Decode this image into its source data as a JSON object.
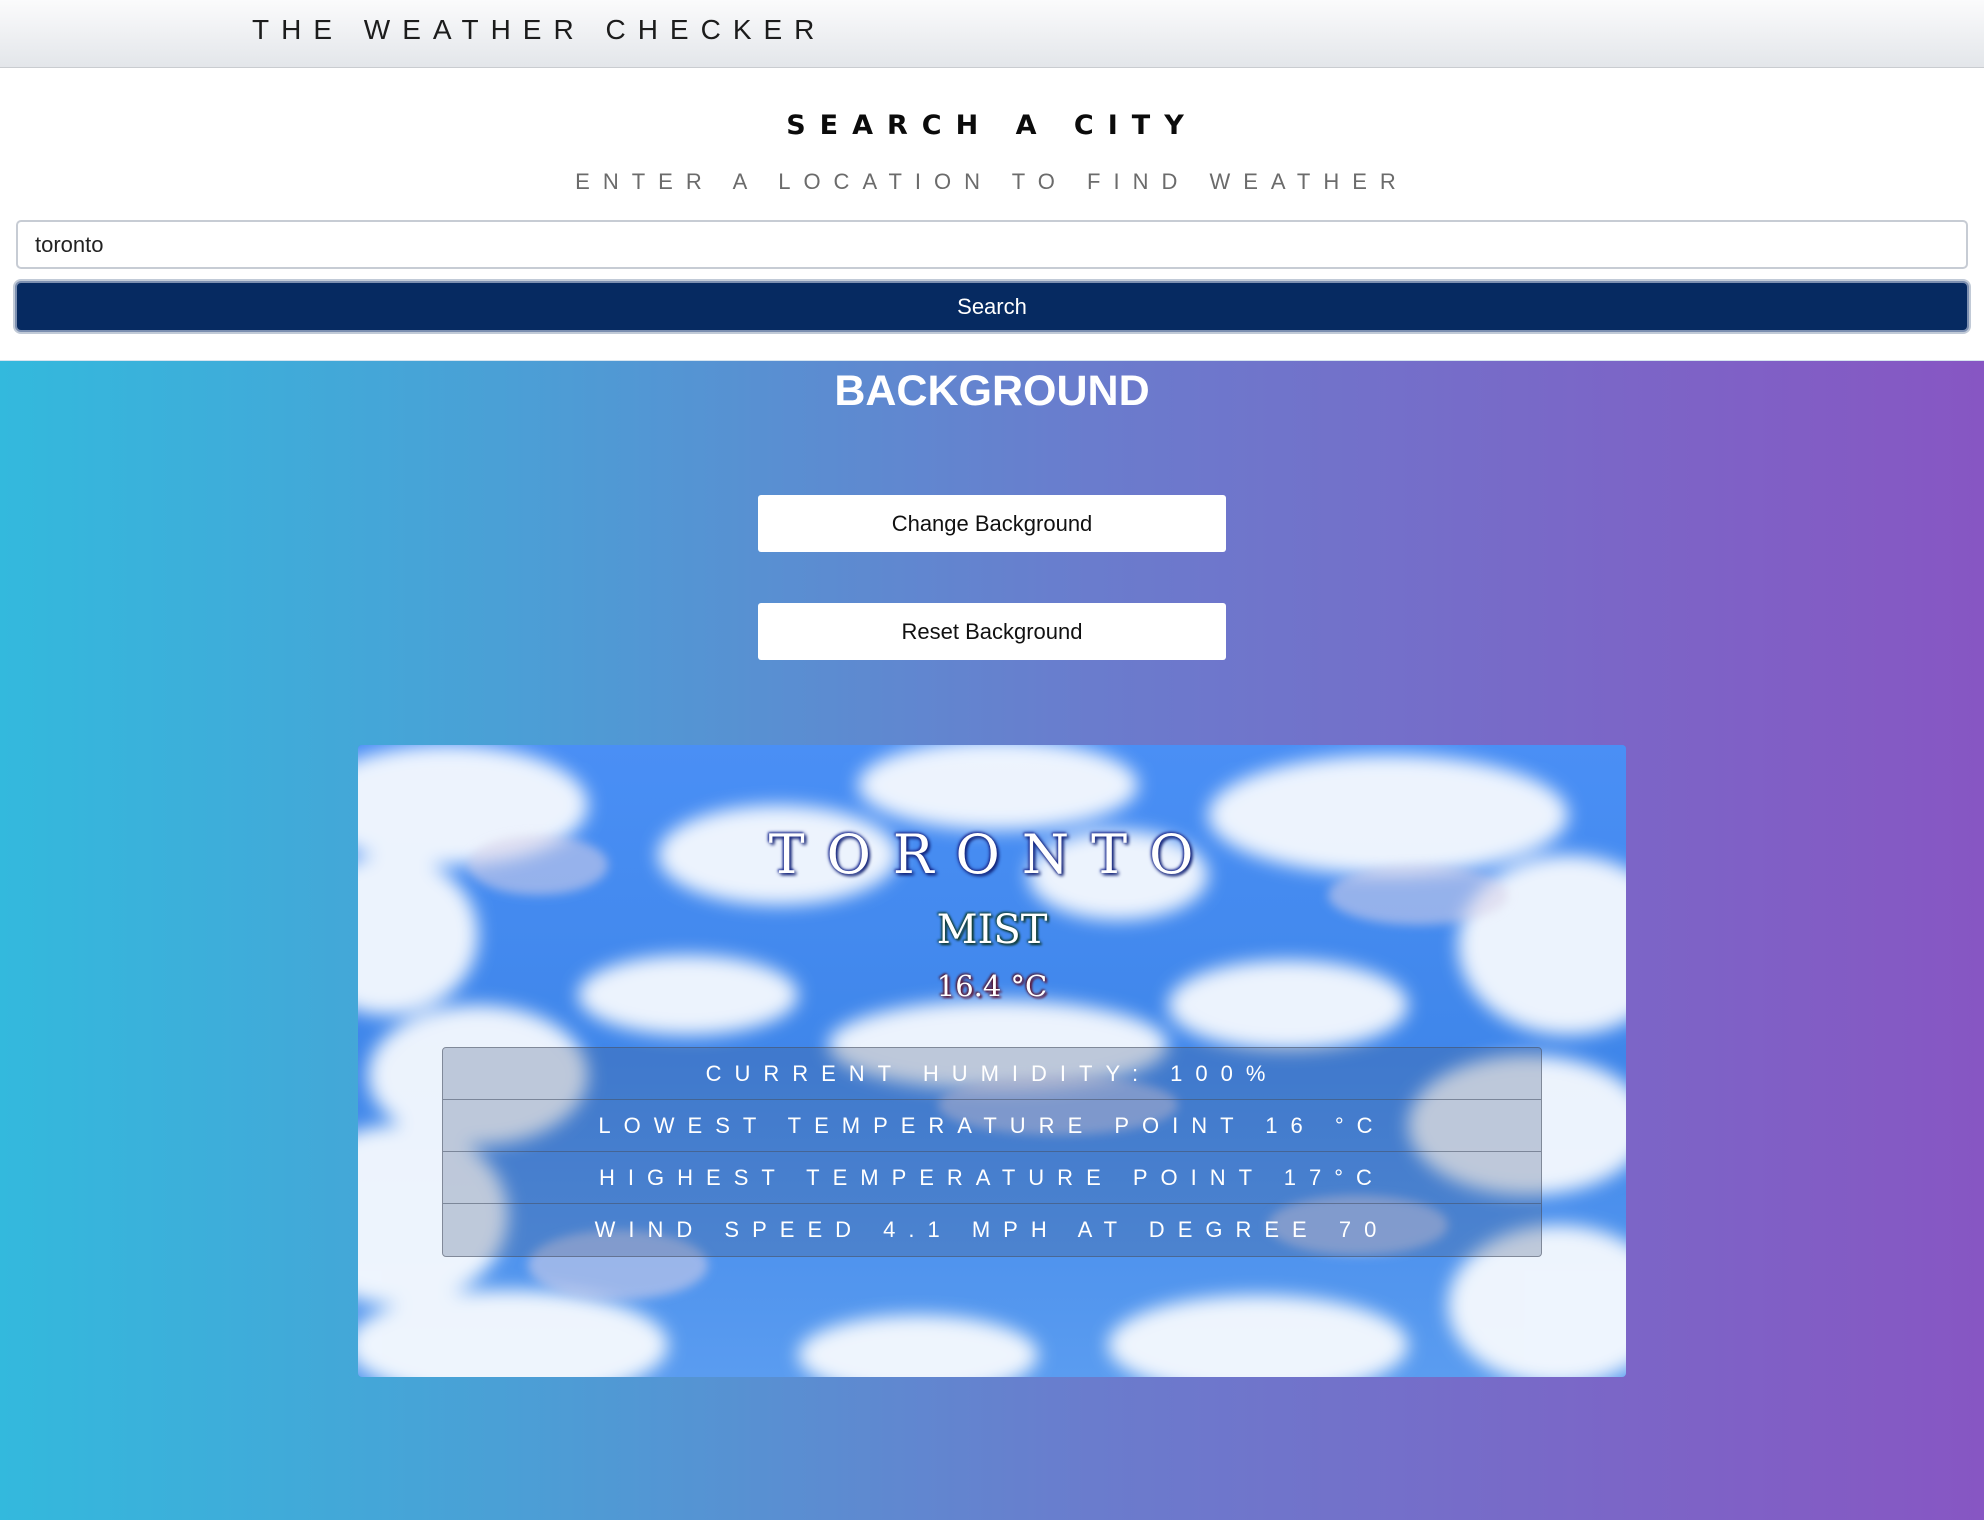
{
  "navbar": {
    "brand": "THE WEATHER CHECKER"
  },
  "search": {
    "title": "SEARCH A CITY",
    "subtitle": "ENTER A LOCATION TO FIND WEATHER",
    "input_value": "toronto",
    "button_label": "Search"
  },
  "background": {
    "heading": "BACKGROUND",
    "change_label": "Change Background",
    "reset_label": "Reset Background"
  },
  "weather": {
    "city": "TORONTO",
    "condition": "MIST",
    "temperature": "16.4 °C",
    "details": [
      "CURRENT HUMIDITY: 100%",
      "LOWEST TEMPERATURE POINT 16 °C",
      "HIGHEST TEMPERATURE POINT 17°C",
      "WIND SPEED 4.1 MPH AT DEGREE 70"
    ]
  },
  "colors": {
    "search_button": "#062a61",
    "gradient_start": "#33b9dd",
    "gradient_end": "#8756c3",
    "sky": "#4b8ef2"
  }
}
